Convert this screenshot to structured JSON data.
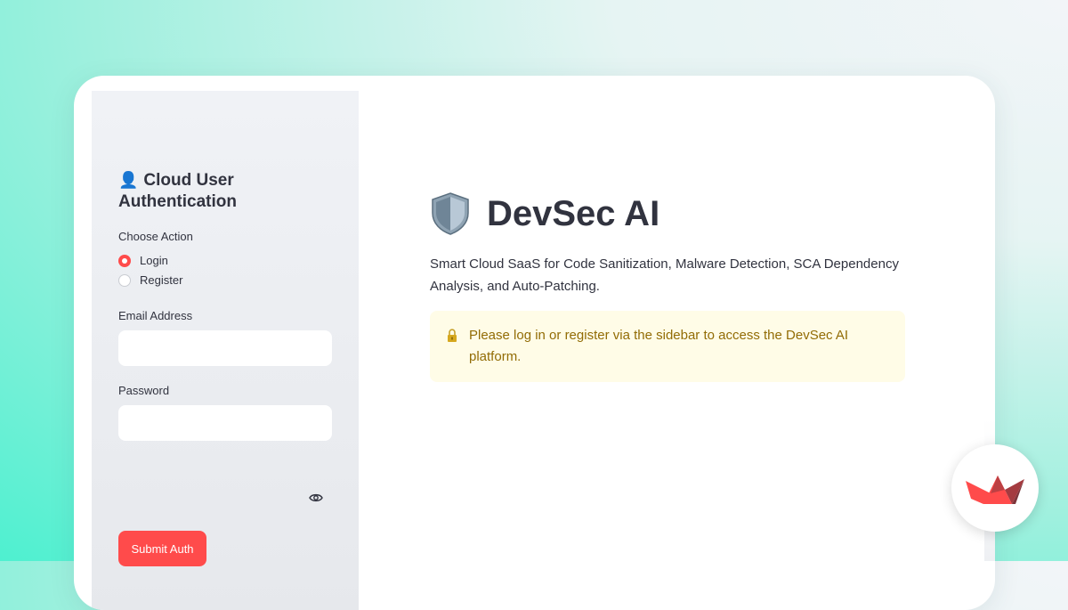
{
  "sidebar": {
    "icon": "user-silhouette-icon",
    "title": "Cloud User Authentication",
    "choose_action_label": "Choose Action",
    "options": [
      {
        "label": "Login",
        "selected": true
      },
      {
        "label": "Register",
        "selected": false
      }
    ],
    "email_label": "Email Address",
    "email_value": "",
    "password_label": "Password",
    "password_value": "",
    "password_toggle_icon": "eye-icon",
    "submit_label": "Submit Auth"
  },
  "main": {
    "title_icon": "shield-icon",
    "title": "DevSec AI",
    "subtitle": "Smart Cloud SaaS for Code Sanitization, Malware Detection, SCA Dependency Analysis, and Auto-Patching.",
    "alert_icon": "lock-icon",
    "alert": "Please log in or register via the sidebar to access the DevSec AI platform."
  },
  "badge_icon": "streamlit-logo-icon",
  "colors": {
    "accent": "#ff4b4b",
    "sidebar_bg": "#f0f2f6",
    "alert_bg": "#fffce7",
    "alert_text": "#926c05",
    "text": "#31333f"
  }
}
